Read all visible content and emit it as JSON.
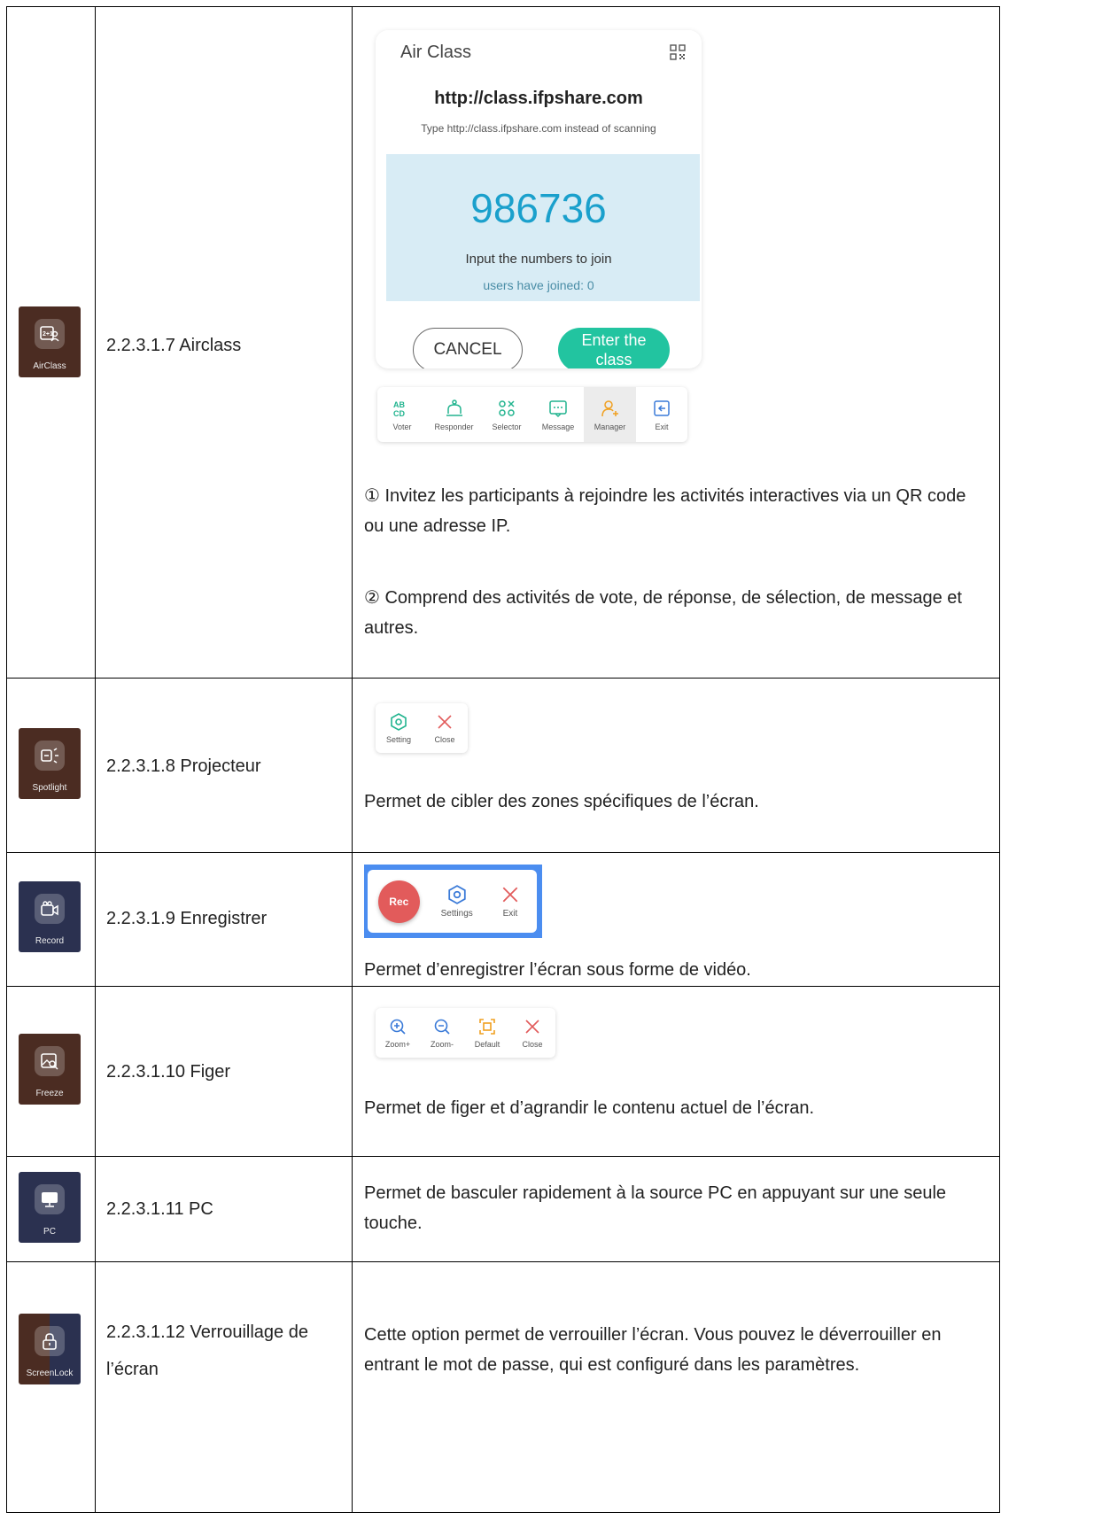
{
  "rows": [
    {
      "icon_label": "AirClass",
      "label": "2.2.3.1.7 Airclass",
      "panel": {
        "title": "Air Class",
        "url": "http://class.ifpshare.com",
        "hint": "Type http://class.ifpshare.com instead of scanning",
        "code": "986736",
        "join_text": "Input the numbers to join",
        "users_text": "users have joined: 0",
        "cancel": "CANCEL",
        "enter_line1": "Enter the",
        "enter_line2": "class"
      },
      "toolbar": [
        "Voter",
        "Responder",
        "Selector",
        "Message",
        "Manager",
        "Exit"
      ],
      "desc1": "① Invitez les participants à rejoindre les activités interactives via un QR code ou une adresse IP.",
      "desc2": "② Comprend des activités de vote, de réponse, de sélection, de message et autres."
    },
    {
      "icon_label": "Spotlight",
      "label": "2.2.3.1.8 Projecteur",
      "toolbar": [
        "Setting",
        "Close"
      ],
      "desc": "Permet de cibler des zones spécifiques de l’écran."
    },
    {
      "icon_label": "Record",
      "label": "2.2.3.1.9 Enregistrer",
      "rec": "Rec",
      "toolbar": [
        "Settings",
        "Exit"
      ],
      "desc": "Permet d’enregistrer l’écran sous forme de vidéo."
    },
    {
      "icon_label": "Freeze",
      "label": "2.2.3.1.10 Figer",
      "toolbar": [
        "Zoom+",
        "Zoom-",
        "Default",
        "Close"
      ],
      "desc": "Permet de figer et d’agrandir le contenu actuel de l’écran."
    },
    {
      "icon_label": "PC",
      "label": "2.2.3.1.11 PC",
      "desc": "Permet de basculer rapidement à la source PC en appuyant sur une seule touche."
    },
    {
      "icon_label": "ScreenLock",
      "label_line1": "2.2.3.1.12 Verrouillage de",
      "label_line2": "l’écran",
      "desc": "Cette option permet de verrouiller l’écran. Vous pouvez le déverrouiller en entrant le mot de passe, qui est configuré dans les paramètres."
    }
  ],
  "colors": {
    "icon_brown": "#4b2c22",
    "icon_navy": "#2b3150",
    "teal": "#22c4a0",
    "code_blue": "#1aa0cc",
    "rec_red": "#e25b5b",
    "orange": "#f0a020"
  },
  "icons": [
    "airclass-icon",
    "spotlight-icon",
    "record-icon",
    "freeze-icon",
    "pc-icon",
    "screenlock-icon"
  ]
}
